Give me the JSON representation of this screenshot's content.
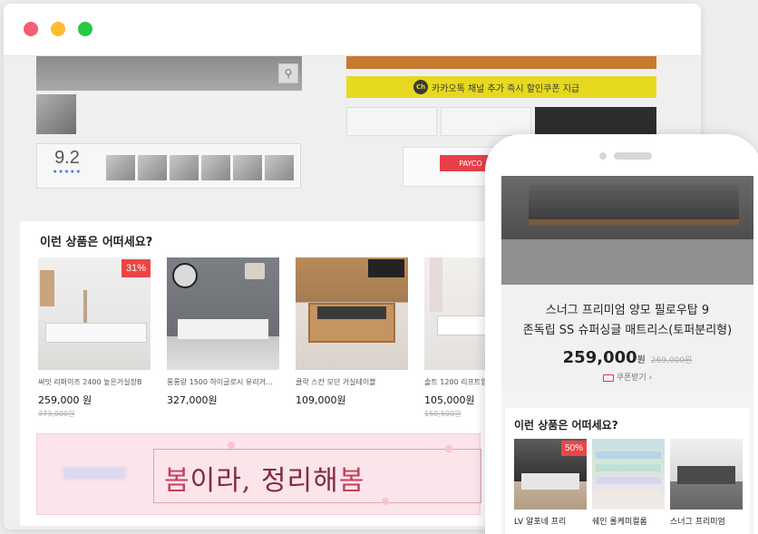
{
  "browser": {
    "dots": [
      "close",
      "minimize",
      "maximize"
    ]
  },
  "product_page": {
    "rating": "9.2",
    "stars": "★★★★★",
    "kakao_text": "카카오톡 채널 추가 즉시 할인쿠폰 지급",
    "kakao_icon": "Ch",
    "payco_label": "PAYCO"
  },
  "recommend": {
    "title": "이런 상품은 어떠세요?",
    "items": [
      {
        "name": "써밋 리퍼이즈 2400 높은거실장B",
        "price": "259,000 원",
        "orig": "373,000원",
        "badge": "31%"
      },
      {
        "name": "롱롱랑 1500 하이글로시 유리거…",
        "price": "327,000원",
        "orig": "",
        "badge": ""
      },
      {
        "name": "클락 스칸 모던 거실테이블",
        "price": "109,000원",
        "orig": "",
        "badge": ""
      },
      {
        "name": "솔트 1200 리프트업…",
        "price": "105,000원",
        "orig": "150,500원",
        "badge": ""
      }
    ]
  },
  "banner": {
    "brand": "동서가구",
    "slogan_a": "봄",
    "slogan_b": "이라, 정리해",
    "slogan_c": "봄"
  },
  "mobile": {
    "product_name_1": "스너그 프리미엄 양모 필로우탑 9",
    "product_name_2": "존독립 SS 슈퍼싱글 매트리스(토퍼분리형)",
    "price": "259,000",
    "price_unit": "원",
    "old_price": "269,000원",
    "coupon": "쿠폰받기 ›",
    "rec_title": "이런 상품은 어떠세요?",
    "items": [
      {
        "name": "LV 알포네 프리",
        "badge": "50%"
      },
      {
        "name": "쉐인 롤케미컬롬",
        "badge": ""
      },
      {
        "name": "스너그 프리미엄",
        "badge": ""
      }
    ]
  }
}
